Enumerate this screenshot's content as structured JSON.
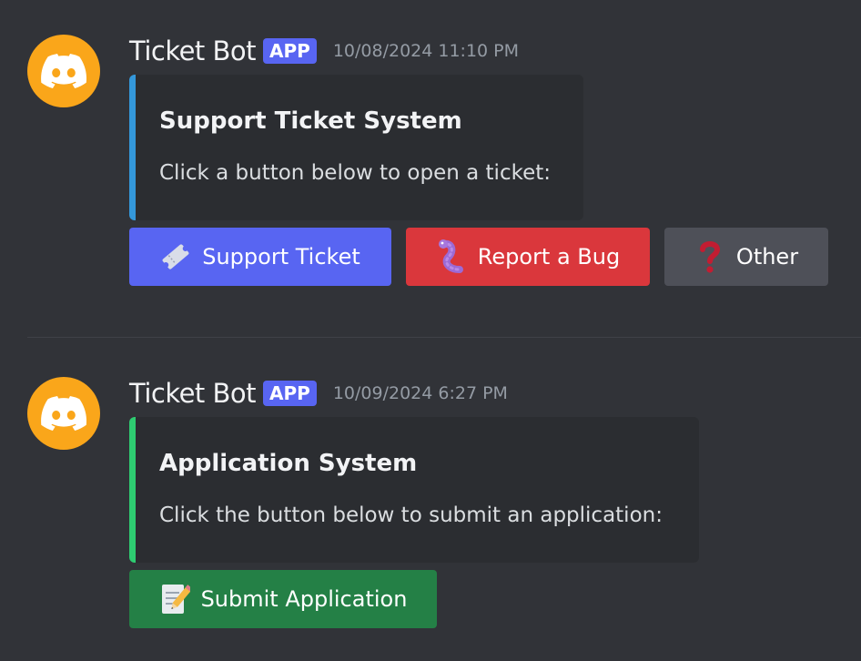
{
  "colors": {
    "background": "#313338",
    "avatar": "#faa61a",
    "app_badge": "#5865f2",
    "embed_background": "#2b2d31",
    "embed1_accent": "#3498db",
    "embed2_accent": "#2ecc71",
    "button_primary": "#5865f2",
    "button_danger": "#da373c",
    "button_secondary": "#4e5058",
    "button_success": "#248046"
  },
  "messages": [
    {
      "avatar_icon": "discord-logo-icon",
      "username": "Ticket Bot",
      "badge": "APP",
      "timestamp": "10/08/2024 11:10 PM",
      "embed": {
        "title": "Support Ticket System",
        "description": "Click a button below to open a ticket:"
      },
      "buttons": [
        {
          "label": "Support Ticket",
          "icon": "ticket-icon"
        },
        {
          "label": "Report a Bug",
          "icon": "worm-icon"
        },
        {
          "label": "Other",
          "icon": "question-mark-icon"
        }
      ]
    },
    {
      "avatar_icon": "discord-logo-icon",
      "username": "Ticket Bot",
      "badge": "APP",
      "timestamp": "10/09/2024 6:27 PM",
      "embed": {
        "title": "Application System",
        "description": "Click the button below to submit an application:"
      },
      "buttons": [
        {
          "label": "Submit Application",
          "icon": "memo-icon"
        }
      ]
    }
  ]
}
